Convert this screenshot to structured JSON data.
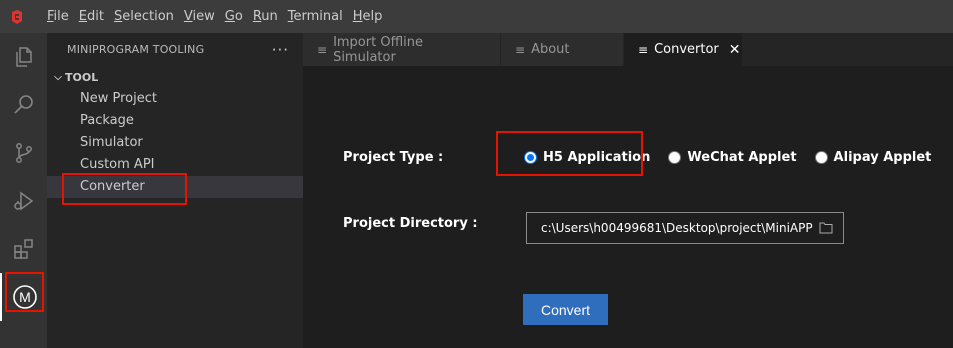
{
  "menu": [
    "File",
    "Edit",
    "Selection",
    "View",
    "Go",
    "Run",
    "Terminal",
    "Help"
  ],
  "menu_mnemonic": [
    "F",
    "E",
    "S",
    "V",
    "G",
    "R",
    "T",
    "H"
  ],
  "menu_rest": [
    "ile",
    "dit",
    "election",
    "iew",
    "o",
    "un",
    "erminal",
    "elp"
  ],
  "activity": {
    "items": [
      "explorer-icon",
      "search-icon",
      "source-control-icon",
      "run-debug-icon",
      "extensions-icon",
      "miniprogram-icon"
    ],
    "miniprogram_glyph": "M"
  },
  "sidebar": {
    "title": "MINIPROGRAM TOOLING",
    "more": "···",
    "section": "TOOL",
    "items": [
      "New Project",
      "Package",
      "Simulator",
      "Custom API",
      "Converter"
    ],
    "selected": "Converter"
  },
  "tabs": [
    {
      "label": "Import Offline Simulator",
      "icon": "preview-icon",
      "active": false
    },
    {
      "label": "About",
      "icon": "preview-icon",
      "active": false
    },
    {
      "label": "Convertor",
      "icon": "preview-icon",
      "active": true,
      "close": "✕"
    }
  ],
  "form": {
    "project_type_label": "Project Type :",
    "options": [
      {
        "label": "H5 Application",
        "checked": true
      },
      {
        "label": "WeChat Applet",
        "checked": false
      },
      {
        "label": "Alipay Applet",
        "checked": false
      }
    ],
    "project_dir_label": "Project Directory :",
    "project_dir_value": "c:\\Users\\h00499681\\Desktop\\project\\MiniAPP",
    "convert_label": "Convert"
  },
  "colors": {
    "highlight": "#e51400",
    "button": "#2f6ebd",
    "logo": "#e0322e"
  }
}
